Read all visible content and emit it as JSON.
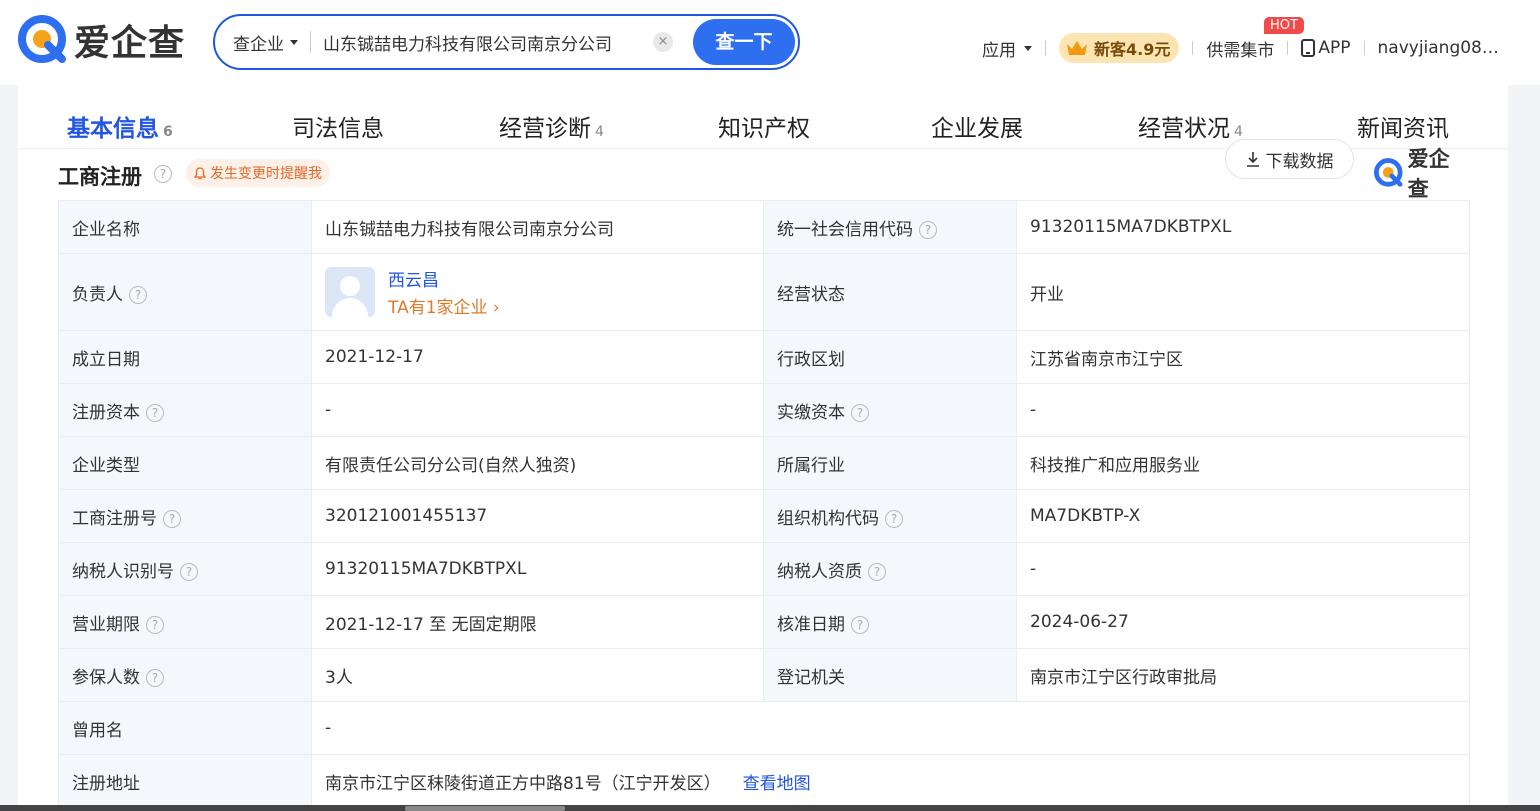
{
  "header": {
    "logo_text": "爱企查",
    "search": {
      "type_label": "查企业",
      "value": "山东铖喆电力科技有限公司南京分公司",
      "clear_glyph": "×",
      "button_label": "查一下"
    },
    "nav": {
      "apps_label": "应用",
      "vip_label": "新客4.9元",
      "market_label": "供需集市",
      "hot_badge": "HOT",
      "app_label": "APP",
      "user_label": "navyjiang08…"
    }
  },
  "tabs": [
    {
      "label": "基本信息",
      "count": "6",
      "active": true
    },
    {
      "label": "司法信息",
      "count": ""
    },
    {
      "label": "经营诊断",
      "count": "4"
    },
    {
      "label": "知识产权",
      "count": ""
    },
    {
      "label": "企业发展",
      "count": ""
    },
    {
      "label": "经营状况",
      "count": "4"
    },
    {
      "label": "新闻资讯",
      "count": ""
    }
  ],
  "section": {
    "title": "工商注册",
    "help_glyph": "?",
    "remind_label": "发生变更时提醒我",
    "download_label": "下载数据",
    "watermark_logo": "爱企查"
  },
  "info": {
    "company_name_label": "企业名称",
    "company_name": "山东铖喆电力科技有限公司南京分公司",
    "credit_code_label": "统一社会信用代码",
    "credit_code": "91320115MA7DKBTPXL",
    "principal_label": "负责人",
    "principal_name": "西云昌",
    "principal_companies": "TA有1家企业 ›",
    "status_label": "经营状态",
    "status": "开业",
    "founded_label": "成立日期",
    "founded": "2021-12-17",
    "region_label": "行政区划",
    "region": "江苏省南京市江宁区",
    "reg_capital_label": "注册资本",
    "reg_capital": "-",
    "paid_capital_label": "实缴资本",
    "paid_capital": "-",
    "type_label": "企业类型",
    "type": "有限责任公司分公司(自然人独资)",
    "industry_label": "所属行业",
    "industry": "科技推广和应用服务业",
    "reg_no_label": "工商注册号",
    "reg_no": "320121001455137",
    "org_code_label": "组织机构代码",
    "org_code": "MA7DKBTP-X",
    "taxpayer_id_label": "纳税人识别号",
    "taxpayer_id": "91320115MA7DKBTPXL",
    "taxpayer_qual_label": "纳税人资质",
    "taxpayer_qual": "-",
    "term_label": "营业期限",
    "term": "2021-12-17 至 无固定期限",
    "approved_label": "核准日期",
    "approved": "2024-06-27",
    "insured_label": "参保人数",
    "insured": "3人",
    "authority_label": "登记机关",
    "authority": "南京市江宁区行政审批局",
    "former_name_label": "曾用名",
    "former_name": "-",
    "address_label": "注册地址",
    "address": "南京市江宁区秣陵街道正方中路81号（江宁开发区）",
    "map_link": "查看地图"
  },
  "colors": {
    "brand_blue": "#2156e0",
    "logo_orange": "#f7a21b",
    "label_bg": "#f4f7fb",
    "remind_orange": "#e06a2a"
  }
}
